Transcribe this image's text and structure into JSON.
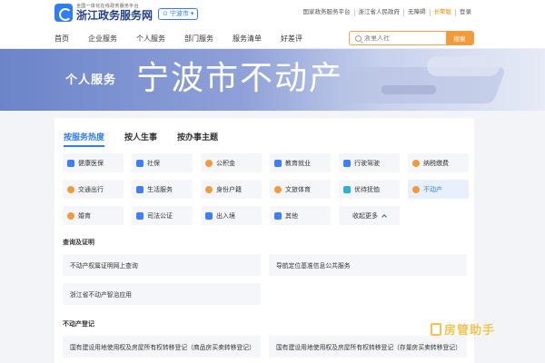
{
  "header": {
    "logo_sub": "全国一体化在线政务服务平台",
    "logo_main": "浙江政务服务网",
    "city_selector": "宁波市",
    "top_links": [
      "国家政务服务平台",
      "浙江省人民政府",
      "无障碍",
      "长辈版",
      "登录"
    ]
  },
  "nav": {
    "items": [
      "首页",
      "企业服务",
      "个人服务",
      "部门服务",
      "服务清单",
      "好差评"
    ],
    "search_placeholder": "浙里人社",
    "search_button": "搜索"
  },
  "banner": {
    "title": "个人服务",
    "city": "宁波市不动产"
  },
  "tabs": [
    "按服务热度",
    "按人生事",
    "按办事主题"
  ],
  "categories": [
    {
      "label": "健康医保",
      "icon": "medical-icon"
    },
    {
      "label": "社保",
      "icon": "shield-icon"
    },
    {
      "label": "公积金",
      "icon": "fund-icon"
    },
    {
      "label": "教育就业",
      "icon": "education-icon"
    },
    {
      "label": "行驶驾驶",
      "icon": "car-icon"
    },
    {
      "label": "纳税缴费",
      "icon": "tax-icon"
    },
    {
      "label": "交通出行",
      "icon": "location-icon"
    },
    {
      "label": "生活服务",
      "icon": "life-icon"
    },
    {
      "label": "身份户籍",
      "icon": "id-card-icon"
    },
    {
      "label": "文旅体育",
      "icon": "culture-icon"
    },
    {
      "label": "优待抚恤",
      "icon": "care-icon"
    },
    {
      "label": "不动产",
      "icon": "property-icon"
    },
    {
      "label": "婚育",
      "icon": "family-icon"
    },
    {
      "label": "司法公证",
      "icon": "justice-icon"
    },
    {
      "label": "出入境",
      "icon": "passport-icon"
    },
    {
      "label": "其他",
      "icon": "other-icon"
    }
  ],
  "collapse_label": "收起更多",
  "sections": [
    {
      "title": "查询及证明",
      "items": [
        "不动产权属证明网上查询",
        "导航定位基准信息公共服务",
        "浙江省不动产智治应用"
      ]
    },
    {
      "title": "不动产登记",
      "items": [
        "国有建设用地使用权及房屋所有权转移登记（商品房买卖转移登记）",
        "国有建设用地使用权及房屋所有权转移登记（存量房买卖转移登记）"
      ]
    }
  ],
  "watermark": "房管助手",
  "colors": {
    "accent": "#2f7cf6",
    "search_orange": "#f39a3b",
    "watermark": "#f3c24f"
  }
}
